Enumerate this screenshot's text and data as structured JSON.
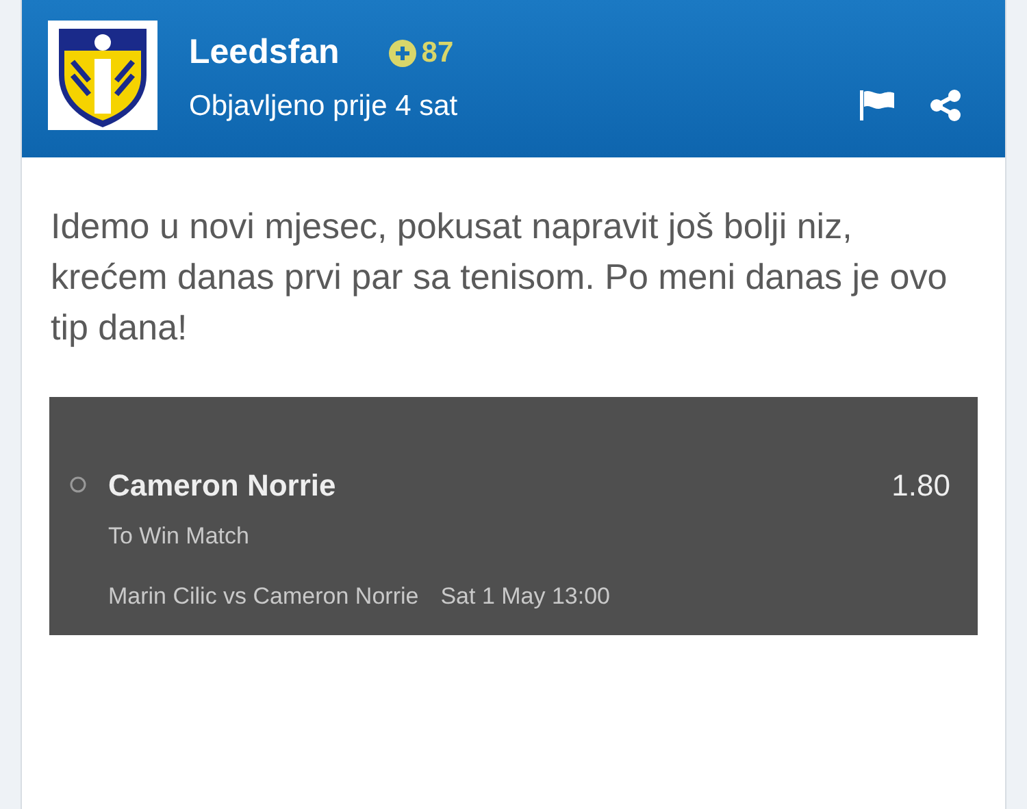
{
  "post": {
    "author": "Leedsfan",
    "points": "87",
    "posted": "Objavljeno prije 4 sat",
    "text": "Idemo u novi mjesec, pokusat napravit još bolji niz, krećem danas prvi par sa tenisom. Po meni danas je ovo tip dana!"
  },
  "bet": {
    "selection": "Cameron Norrie",
    "odds": "1.80",
    "market": "To Win Match",
    "event": "Marin Cilic vs Cameron Norrie",
    "time": "Sat 1 May 13:00"
  }
}
